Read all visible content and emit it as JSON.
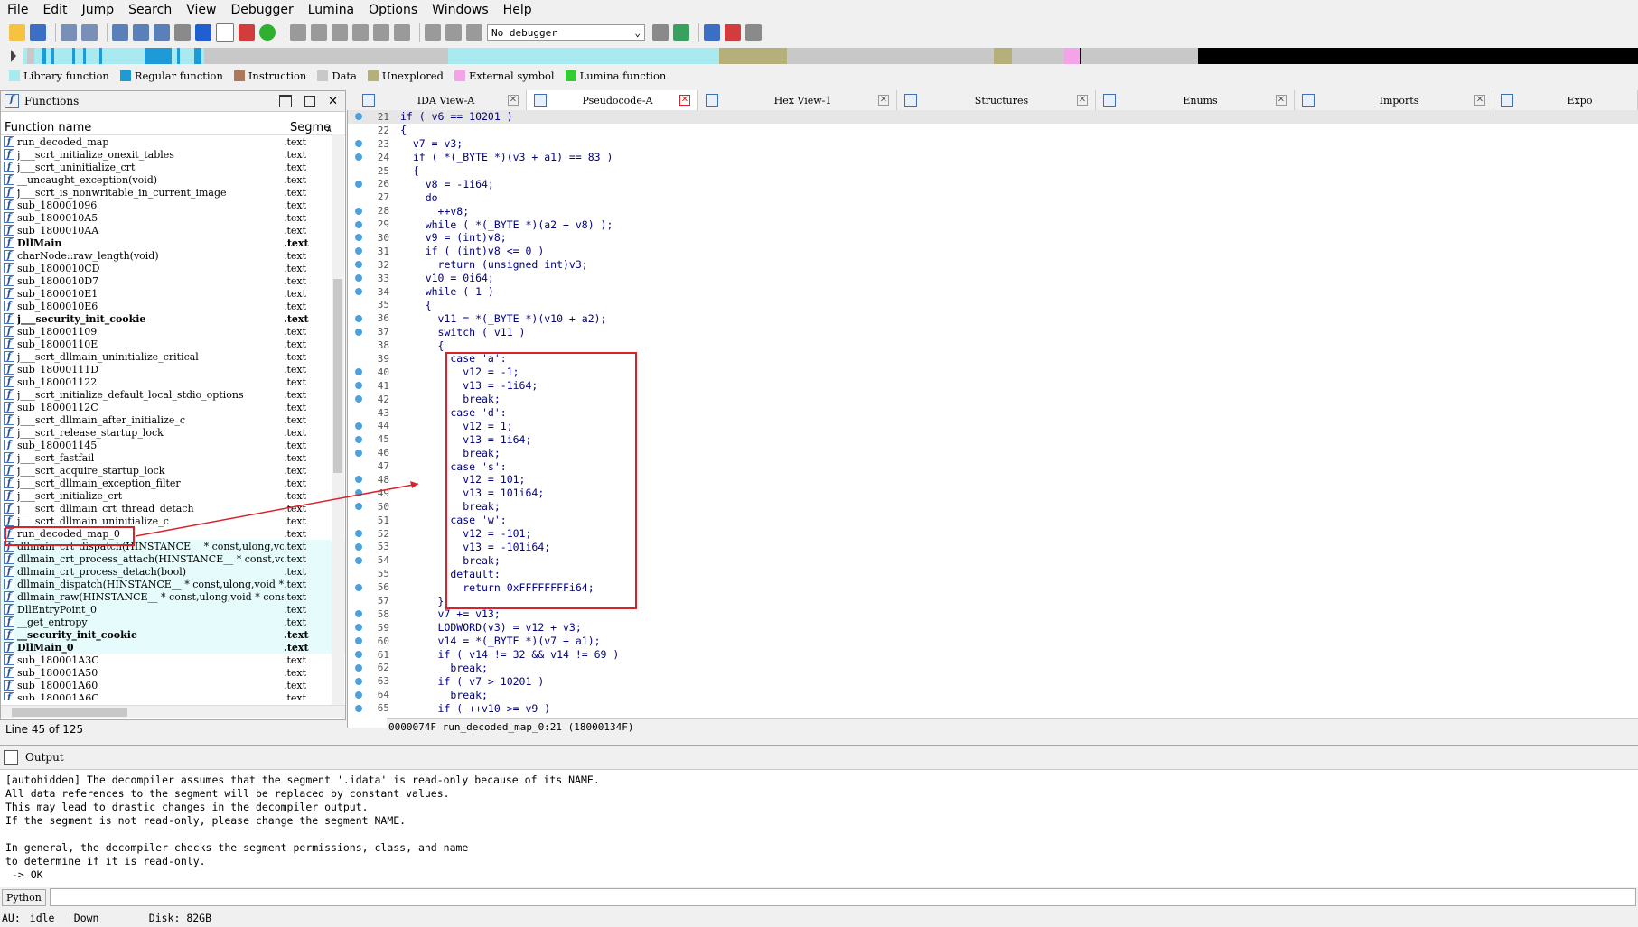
{
  "menu": [
    "File",
    "Edit",
    "Jump",
    "Search",
    "View",
    "Debugger",
    "Lumina",
    "Options",
    "Windows",
    "Help"
  ],
  "toolbar": {
    "debugger_select": "No debugger"
  },
  "legend": [
    {
      "label": "Library function",
      "color": "#a8eaf0"
    },
    {
      "label": "Regular function",
      "color": "#1e9bd7"
    },
    {
      "label": "Instruction",
      "color": "#b0785a"
    },
    {
      "label": "Data",
      "color": "#c8c8c8"
    },
    {
      "label": "Unexplored",
      "color": "#b5b07a"
    },
    {
      "label": "External symbol",
      "color": "#f5a3e8"
    },
    {
      "label": "Lumina function",
      "color": "#33cc33"
    }
  ],
  "functions_panel": {
    "title": "Functions",
    "col_name": "Function name",
    "col_segment": "Segme",
    "line_info": "Line 45 of 125",
    "rows": [
      {
        "name": "run_decoded_map",
        "seg": ".text",
        "bold": false,
        "hl": false
      },
      {
        "name": "j___scrt_initialize_onexit_tables",
        "seg": ".text",
        "bold": false,
        "hl": false
      },
      {
        "name": "j___scrt_uninitialize_crt",
        "seg": ".text",
        "bold": false,
        "hl": false
      },
      {
        "name": "__uncaught_exception(void)",
        "seg": ".text",
        "bold": false,
        "hl": false
      },
      {
        "name": "j___scrt_is_nonwritable_in_current_image",
        "seg": ".text",
        "bold": false,
        "hl": false
      },
      {
        "name": "sub_180001096",
        "seg": ".text",
        "bold": false,
        "hl": false
      },
      {
        "name": "sub_1800010A5",
        "seg": ".text",
        "bold": false,
        "hl": false
      },
      {
        "name": "sub_1800010AA",
        "seg": ".text",
        "bold": false,
        "hl": false
      },
      {
        "name": "DllMain",
        "seg": ".text",
        "bold": true,
        "hl": false
      },
      {
        "name": "charNode::raw_length(void)",
        "seg": ".text",
        "bold": false,
        "hl": false
      },
      {
        "name": "sub_1800010CD",
        "seg": ".text",
        "bold": false,
        "hl": false
      },
      {
        "name": "sub_1800010D7",
        "seg": ".text",
        "bold": false,
        "hl": false
      },
      {
        "name": "sub_1800010E1",
        "seg": ".text",
        "bold": false,
        "hl": false
      },
      {
        "name": "sub_1800010E6",
        "seg": ".text",
        "bold": false,
        "hl": false
      },
      {
        "name": "j___security_init_cookie",
        "seg": ".text",
        "bold": true,
        "hl": false
      },
      {
        "name": "sub_180001109",
        "seg": ".text",
        "bold": false,
        "hl": false
      },
      {
        "name": "sub_18000110E",
        "seg": ".text",
        "bold": false,
        "hl": false
      },
      {
        "name": "j___scrt_dllmain_uninitialize_critical",
        "seg": ".text",
        "bold": false,
        "hl": false
      },
      {
        "name": "sub_18000111D",
        "seg": ".text",
        "bold": false,
        "hl": false
      },
      {
        "name": "sub_180001122",
        "seg": ".text",
        "bold": false,
        "hl": false
      },
      {
        "name": "j___scrt_initialize_default_local_stdio_options",
        "seg": ".text",
        "bold": false,
        "hl": false
      },
      {
        "name": "sub_18000112C",
        "seg": ".text",
        "bold": false,
        "hl": false
      },
      {
        "name": "j___scrt_dllmain_after_initialize_c",
        "seg": ".text",
        "bold": false,
        "hl": false
      },
      {
        "name": "j___scrt_release_startup_lock",
        "seg": ".text",
        "bold": false,
        "hl": false
      },
      {
        "name": "sub_180001145",
        "seg": ".text",
        "bold": false,
        "hl": false
      },
      {
        "name": "j___scrt_fastfail",
        "seg": ".text",
        "bold": false,
        "hl": false
      },
      {
        "name": "j___scrt_acquire_startup_lock",
        "seg": ".text",
        "bold": false,
        "hl": false
      },
      {
        "name": "j___scrt_dllmain_exception_filter",
        "seg": ".text",
        "bold": false,
        "hl": false
      },
      {
        "name": "j___scrt_initialize_crt",
        "seg": ".text",
        "bold": false,
        "hl": false
      },
      {
        "name": "j___scrt_dllmain_crt_thread_detach",
        "seg": ".text",
        "bold": false,
        "hl": false
      },
      {
        "name": "j___scrt_dllmain_uninitialize_c",
        "seg": ".text",
        "bold": false,
        "hl": false
      },
      {
        "name": "run_decoded_map_0",
        "seg": ".text",
        "bold": false,
        "hl": false
      },
      {
        "name": "dllmain_crt_dispatch(HINSTANCE__ * const,ulong,void * const)",
        "seg": ".text",
        "bold": false,
        "hl": true
      },
      {
        "name": "dllmain_crt_process_attach(HINSTANCE__ * const,void * const)",
        "seg": ".text",
        "bold": false,
        "hl": true
      },
      {
        "name": "dllmain_crt_process_detach(bool)",
        "seg": ".text",
        "bold": false,
        "hl": true
      },
      {
        "name": "dllmain_dispatch(HINSTANCE__ * const,ulong,void * const)",
        "seg": ".text",
        "bold": false,
        "hl": true
      },
      {
        "name": "dllmain_raw(HINSTANCE__ * const,ulong,void * const)",
        "seg": ".text",
        "bold": false,
        "hl": true
      },
      {
        "name": "DllEntryPoint_0",
        "seg": ".text",
        "bold": false,
        "hl": true
      },
      {
        "name": "__get_entropy",
        "seg": ".text",
        "bold": false,
        "hl": true
      },
      {
        "name": "__security_init_cookie",
        "seg": ".text",
        "bold": true,
        "hl": true
      },
      {
        "name": "DllMain_0",
        "seg": ".text",
        "bold": true,
        "hl": true
      },
      {
        "name": "sub_180001A3C",
        "seg": ".text",
        "bold": false,
        "hl": false
      },
      {
        "name": "sub_180001A50",
        "seg": ".text",
        "bold": false,
        "hl": false
      },
      {
        "name": "sub_180001A60",
        "seg": ".text",
        "bold": false,
        "hl": false
      },
      {
        "name": "sub_180001A6C",
        "seg": ".text",
        "bold": false,
        "hl": false
      }
    ]
  },
  "tabs": [
    {
      "label": "IDA View-A",
      "active": false
    },
    {
      "label": "Pseudocode-A",
      "active": true
    },
    {
      "label": "Hex View-1",
      "active": false
    },
    {
      "label": "Structures",
      "active": false
    },
    {
      "label": "Enums",
      "active": false
    },
    {
      "label": "Imports",
      "active": false
    },
    {
      "label": "Expo",
      "active": false
    }
  ],
  "code": [
    {
      "n": "21",
      "dot": true,
      "t": "if ( v6 == 10201 )"
    },
    {
      "n": "22",
      "dot": false,
      "t": "{"
    },
    {
      "n": "23",
      "dot": true,
      "t": "  v7 = v3;"
    },
    {
      "n": "24",
      "dot": true,
      "t": "  if ( *(_BYTE *)(v3 + a1) == 83 )"
    },
    {
      "n": "25",
      "dot": false,
      "t": "  {"
    },
    {
      "n": "26",
      "dot": true,
      "t": "    v8 = -1i64;"
    },
    {
      "n": "27",
      "dot": false,
      "t": "    do"
    },
    {
      "n": "28",
      "dot": true,
      "t": "      ++v8;"
    },
    {
      "n": "29",
      "dot": true,
      "t": "    while ( *(_BYTE *)(a2 + v8) );"
    },
    {
      "n": "30",
      "dot": true,
      "t": "    v9 = (int)v8;"
    },
    {
      "n": "31",
      "dot": true,
      "t": "    if ( (int)v8 <= 0 )"
    },
    {
      "n": "32",
      "dot": true,
      "t": "      return (unsigned int)v3;"
    },
    {
      "n": "33",
      "dot": true,
      "t": "    v10 = 0i64;"
    },
    {
      "n": "34",
      "dot": true,
      "t": "    while ( 1 )"
    },
    {
      "n": "35",
      "dot": false,
      "t": "    {"
    },
    {
      "n": "36",
      "dot": true,
      "t": "      v11 = *(_BYTE *)(v10 + a2);"
    },
    {
      "n": "37",
      "dot": true,
      "t": "      switch ( v11 )"
    },
    {
      "n": "38",
      "dot": false,
      "t": "      {"
    },
    {
      "n": "39",
      "dot": false,
      "t": "        case 'a':"
    },
    {
      "n": "40",
      "dot": true,
      "t": "          v12 = -1;"
    },
    {
      "n": "41",
      "dot": true,
      "t": "          v13 = -1i64;"
    },
    {
      "n": "42",
      "dot": true,
      "t": "          break;"
    },
    {
      "n": "43",
      "dot": false,
      "t": "        case 'd':"
    },
    {
      "n": "44",
      "dot": true,
      "t": "          v12 = 1;"
    },
    {
      "n": "45",
      "dot": true,
      "t": "          v13 = 1i64;"
    },
    {
      "n": "46",
      "dot": true,
      "t": "          break;"
    },
    {
      "n": "47",
      "dot": false,
      "t": "        case 's':"
    },
    {
      "n": "48",
      "dot": true,
      "t": "          v12 = 101;"
    },
    {
      "n": "49",
      "dot": true,
      "t": "          v13 = 101i64;"
    },
    {
      "n": "50",
      "dot": true,
      "t": "          break;"
    },
    {
      "n": "51",
      "dot": false,
      "t": "        case 'w':"
    },
    {
      "n": "52",
      "dot": true,
      "t": "          v12 = -101;"
    },
    {
      "n": "53",
      "dot": true,
      "t": "          v13 = -101i64;"
    },
    {
      "n": "54",
      "dot": true,
      "t": "          break;"
    },
    {
      "n": "55",
      "dot": false,
      "t": "        default:"
    },
    {
      "n": "56",
      "dot": true,
      "t": "          return 0xFFFFFFFFi64;"
    },
    {
      "n": "57",
      "dot": false,
      "t": "      }"
    },
    {
      "n": "58",
      "dot": true,
      "t": "      v7 += v13;"
    },
    {
      "n": "59",
      "dot": true,
      "t": "      LODWORD(v3) = v12 + v3;"
    },
    {
      "n": "60",
      "dot": true,
      "t": "      v14 = *(_BYTE *)(v7 + a1);"
    },
    {
      "n": "61",
      "dot": true,
      "t": "      if ( v14 != 32 && v14 != 69 )"
    },
    {
      "n": "62",
      "dot": true,
      "t": "        break;"
    },
    {
      "n": "63",
      "dot": true,
      "t": "      if ( v7 > 10201 )"
    },
    {
      "n": "64",
      "dot": true,
      "t": "        break;"
    },
    {
      "n": "65",
      "dot": true,
      "t": "      if ( ++v10 >= v9 )"
    }
  ],
  "code_status": "0000074F run_decoded_map_0:21 (18000134F)",
  "output": {
    "title": "Output",
    "lines": [
      "[autohidden] The decompiler assumes that the segment '.idata' is read-only because of its NAME.",
      "All data references to the segment will be replaced by constant values.",
      "This may lead to drastic changes in the decompiler output.",
      "If the segment is not read-only, please change the segment NAME.",
      "",
      "In general, the decompiler checks the segment permissions, class, and name",
      "to determine if it is read-only.",
      " -> OK"
    ]
  },
  "python_button": "Python",
  "statusbar": {
    "au": "AU:",
    "state": "idle",
    "direction": "Down",
    "disk": "Disk: 82GB"
  }
}
